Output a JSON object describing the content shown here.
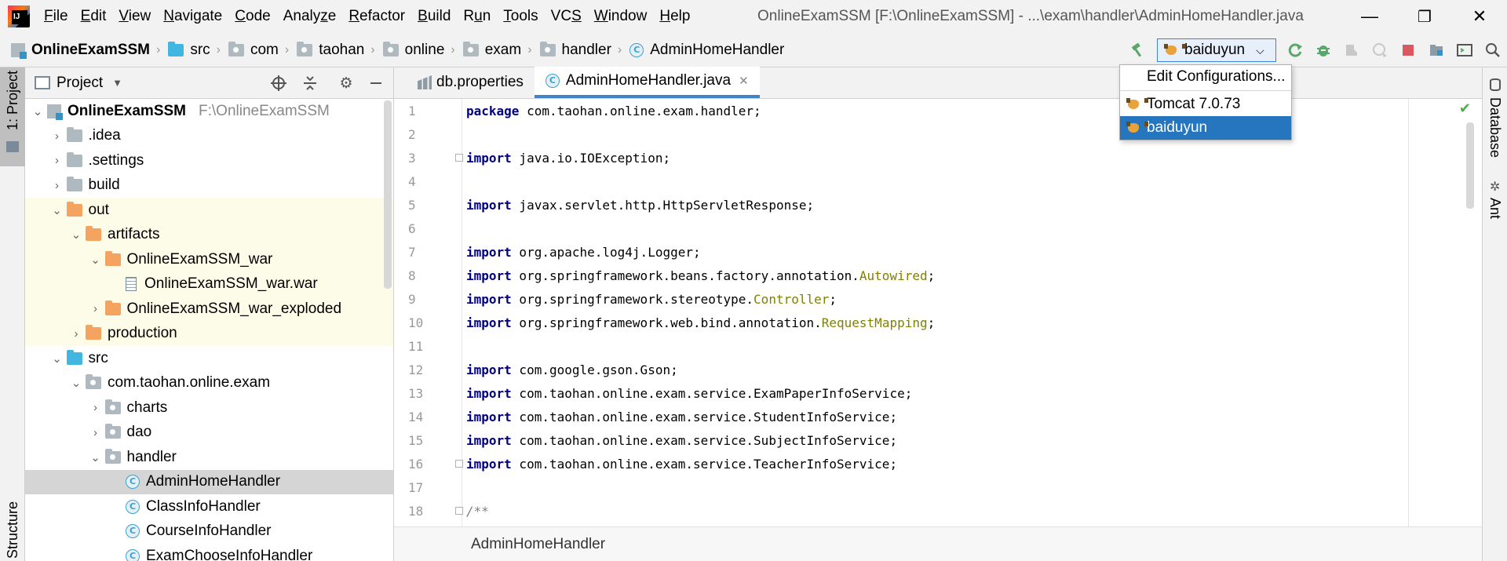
{
  "window": {
    "title": "OnlineExamSSM [F:\\OnlineExamSSM] - ...\\exam\\handler\\AdminHomeHandler.java",
    "minimize": "—",
    "restore": "❐",
    "close": "✕"
  },
  "menu": [
    {
      "pre": "",
      "u": "F",
      "post": "ile"
    },
    {
      "pre": "",
      "u": "E",
      "post": "dit"
    },
    {
      "pre": "",
      "u": "V",
      "post": "iew"
    },
    {
      "pre": "",
      "u": "N",
      "post": "avigate"
    },
    {
      "pre": "",
      "u": "C",
      "post": "ode"
    },
    {
      "pre": "Analy",
      "u": "z",
      "post": "e"
    },
    {
      "pre": "",
      "u": "R",
      "post": "efactor"
    },
    {
      "pre": "",
      "u": "B",
      "post": "uild"
    },
    {
      "pre": "R",
      "u": "u",
      "post": "n"
    },
    {
      "pre": "",
      "u": "T",
      "post": "ools"
    },
    {
      "pre": "VC",
      "u": "S",
      "post": ""
    },
    {
      "pre": "",
      "u": "W",
      "post": "indow"
    },
    {
      "pre": "",
      "u": "H",
      "post": "elp"
    }
  ],
  "navbar": {
    "crumbs": [
      "OnlineExamSSM",
      "src",
      "com",
      "taohan",
      "online",
      "exam",
      "handler",
      "AdminHomeHandler"
    ],
    "separator": "›"
  },
  "run_config": {
    "selected": "baiduyun",
    "caret": "⌵"
  },
  "dropdown": {
    "edit": "Edit Configurations...",
    "items": [
      "Tomcat 7.0.73",
      "baiduyun"
    ]
  },
  "left_strip": {
    "project_tab": "1: Project",
    "structure_tab": "Structure"
  },
  "right_strip": {
    "database_tab": "Database",
    "ant_tab": "Ant"
  },
  "project_panel": {
    "title": "Project",
    "tree": [
      {
        "label": "OnlineExamSSM",
        "hint": "F:\\OnlineExamSSM",
        "arrow": "⌄",
        "icon": "module"
      },
      {
        "label": ".idea",
        "arrow": "›",
        "icon": "folder"
      },
      {
        "label": ".settings",
        "arrow": "›",
        "icon": "folder"
      },
      {
        "label": "build",
        "arrow": "›",
        "icon": "folder"
      },
      {
        "label": "out",
        "arrow": "⌄",
        "icon": "orange"
      },
      {
        "label": "artifacts",
        "arrow": "⌄",
        "icon": "orange"
      },
      {
        "label": "OnlineExamSSM_war",
        "arrow": "⌄",
        "icon": "orange"
      },
      {
        "label": "OnlineExamSSM_war.war",
        "arrow": "",
        "icon": "war"
      },
      {
        "label": "OnlineExamSSM_war_exploded",
        "arrow": "›",
        "icon": "orange"
      },
      {
        "label": "production",
        "arrow": "›",
        "icon": "orange"
      },
      {
        "label": "src",
        "arrow": "⌄",
        "icon": "blue"
      },
      {
        "label": "com.taohan.online.exam",
        "arrow": "⌄",
        "icon": "pkg"
      },
      {
        "label": "charts",
        "arrow": "›",
        "icon": "pkg"
      },
      {
        "label": "dao",
        "arrow": "›",
        "icon": "pkg"
      },
      {
        "label": "handler",
        "arrow": "⌄",
        "icon": "pkg"
      },
      {
        "label": "AdminHomeHandler",
        "arrow": "",
        "icon": "class"
      },
      {
        "label": "ClassInfoHandler",
        "arrow": "",
        "icon": "class"
      },
      {
        "label": "CourseInfoHandler",
        "arrow": "",
        "icon": "class"
      },
      {
        "label": "ExamChooseInfoHandler",
        "arrow": "",
        "icon": "class"
      }
    ]
  },
  "tabs": [
    {
      "label": "db.properties"
    },
    {
      "label": "AdminHomeHandler.java",
      "close": "✕"
    }
  ],
  "editor": {
    "lines": [
      {
        "n": "1",
        "kw": "package",
        "rest": " com.taohan.online.exam.handler;",
        "ann": "",
        "tail": ""
      },
      {
        "n": "2",
        "kw": "",
        "rest": "",
        "ann": "",
        "tail": ""
      },
      {
        "n": "3",
        "kw": "import",
        "rest": " java.io.IOException;",
        "ann": "",
        "tail": ""
      },
      {
        "n": "4",
        "kw": "",
        "rest": "",
        "ann": "",
        "tail": ""
      },
      {
        "n": "5",
        "kw": "import",
        "rest": " javax.servlet.http.HttpServletResponse;",
        "ann": "",
        "tail": ""
      },
      {
        "n": "6",
        "kw": "",
        "rest": "",
        "ann": "",
        "tail": ""
      },
      {
        "n": "7",
        "kw": "import",
        "rest": " org.apache.log4j.Logger;",
        "ann": "",
        "tail": ""
      },
      {
        "n": "8",
        "kw": "import",
        "rest": " org.springframework.beans.factory.annotation.",
        "ann": "Autowired",
        "tail": ";"
      },
      {
        "n": "9",
        "kw": "import",
        "rest": " org.springframework.stereotype.",
        "ann": "Controller",
        "tail": ";"
      },
      {
        "n": "10",
        "kw": "import",
        "rest": " org.springframework.web.bind.annotation.",
        "ann": "RequestMapping",
        "tail": ";"
      },
      {
        "n": "11",
        "kw": "",
        "rest": "",
        "ann": "",
        "tail": ""
      },
      {
        "n": "12",
        "kw": "import",
        "rest": " com.google.gson.Gson;",
        "ann": "",
        "tail": ""
      },
      {
        "n": "13",
        "kw": "import",
        "rest": " com.taohan.online.exam.service.ExamPaperInfoService;",
        "ann": "",
        "tail": ""
      },
      {
        "n": "14",
        "kw": "import",
        "rest": " com.taohan.online.exam.service.StudentInfoService;",
        "ann": "",
        "tail": ""
      },
      {
        "n": "15",
        "kw": "import",
        "rest": " com.taohan.online.exam.service.SubjectInfoService;",
        "ann": "",
        "tail": ""
      },
      {
        "n": "16",
        "kw": "import",
        "rest": " com.taohan.online.exam.service.TeacherInfoService;",
        "ann": "",
        "tail": ""
      },
      {
        "n": "17",
        "kw": "",
        "rest": "",
        "ann": "",
        "tail": ""
      },
      {
        "n": "18",
        "kw": "",
        "rest": "",
        "ann": "",
        "tail": "",
        "comment": "/**"
      }
    ]
  },
  "breadcrumb": "AdminHomeHandler",
  "colors": {
    "keyword": "#000080",
    "annotation": "#808000",
    "selection": "#2675bf"
  }
}
